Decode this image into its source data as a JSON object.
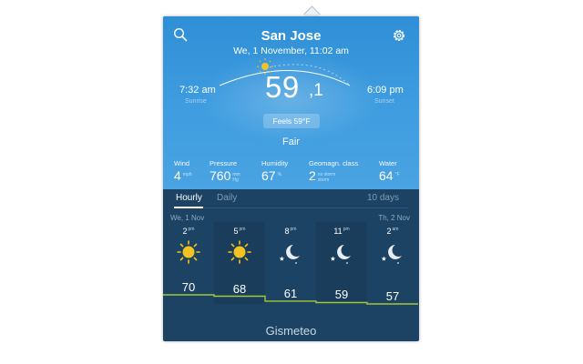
{
  "header": {
    "city": "San Jose",
    "datetime": "We, 1 November, 11:02 am",
    "search_icon": "search-icon",
    "settings_icon": "gear-icon"
  },
  "sun": {
    "sunrise_time": "7:32 am",
    "sunrise_label": "Sunrise",
    "sunset_time": "6:09 pm",
    "sunset_label": "Sunset"
  },
  "current": {
    "temp_whole": "59",
    "temp_decimal": ",1",
    "feels": "Feels  59°F",
    "condition": "Fair"
  },
  "stats": [
    {
      "label": "Wind",
      "value": "4",
      "unit1": "mph",
      "unit2": "",
      "color": "#ffffff"
    },
    {
      "label": "Pressure",
      "value": "760",
      "unit1": "mm",
      "unit2": "Hg"
    },
    {
      "label": "Humidity",
      "value": "67",
      "unit1": "%",
      "unit2": ""
    },
    {
      "label": "Geomagn. class",
      "value": "2",
      "unit1": "no storm",
      "unit2": "storm"
    },
    {
      "label": "Water",
      "value": "64",
      "unit1": "°F",
      "unit2": ""
    }
  ],
  "tabs": {
    "hourly": "Hourly",
    "daily": "Daily",
    "ten_days": "10 days"
  },
  "days": {
    "left": "We, 1 Nov",
    "right": "Th, 2 Nov"
  },
  "hours": [
    {
      "hour": "2",
      "ampm": "pm",
      "icon": "sun-icon",
      "temp": "70"
    },
    {
      "hour": "5",
      "ampm": "pm",
      "icon": "sun-icon",
      "temp": "68"
    },
    {
      "hour": "8",
      "ampm": "pm",
      "icon": "moon-stars-icon",
      "temp": "61"
    },
    {
      "hour": "11",
      "ampm": "pm",
      "icon": "moon-stars-icon",
      "temp": "59"
    },
    {
      "hour": "2",
      "ampm": "am",
      "icon": "moon-stars-icon",
      "temp": "57"
    }
  ],
  "brand": "Gismeteo",
  "colors": {
    "sky": "#3f9de0",
    "panel": "#1c4363",
    "sun": "#f5c320",
    "temp_line": "#a3c83a"
  }
}
